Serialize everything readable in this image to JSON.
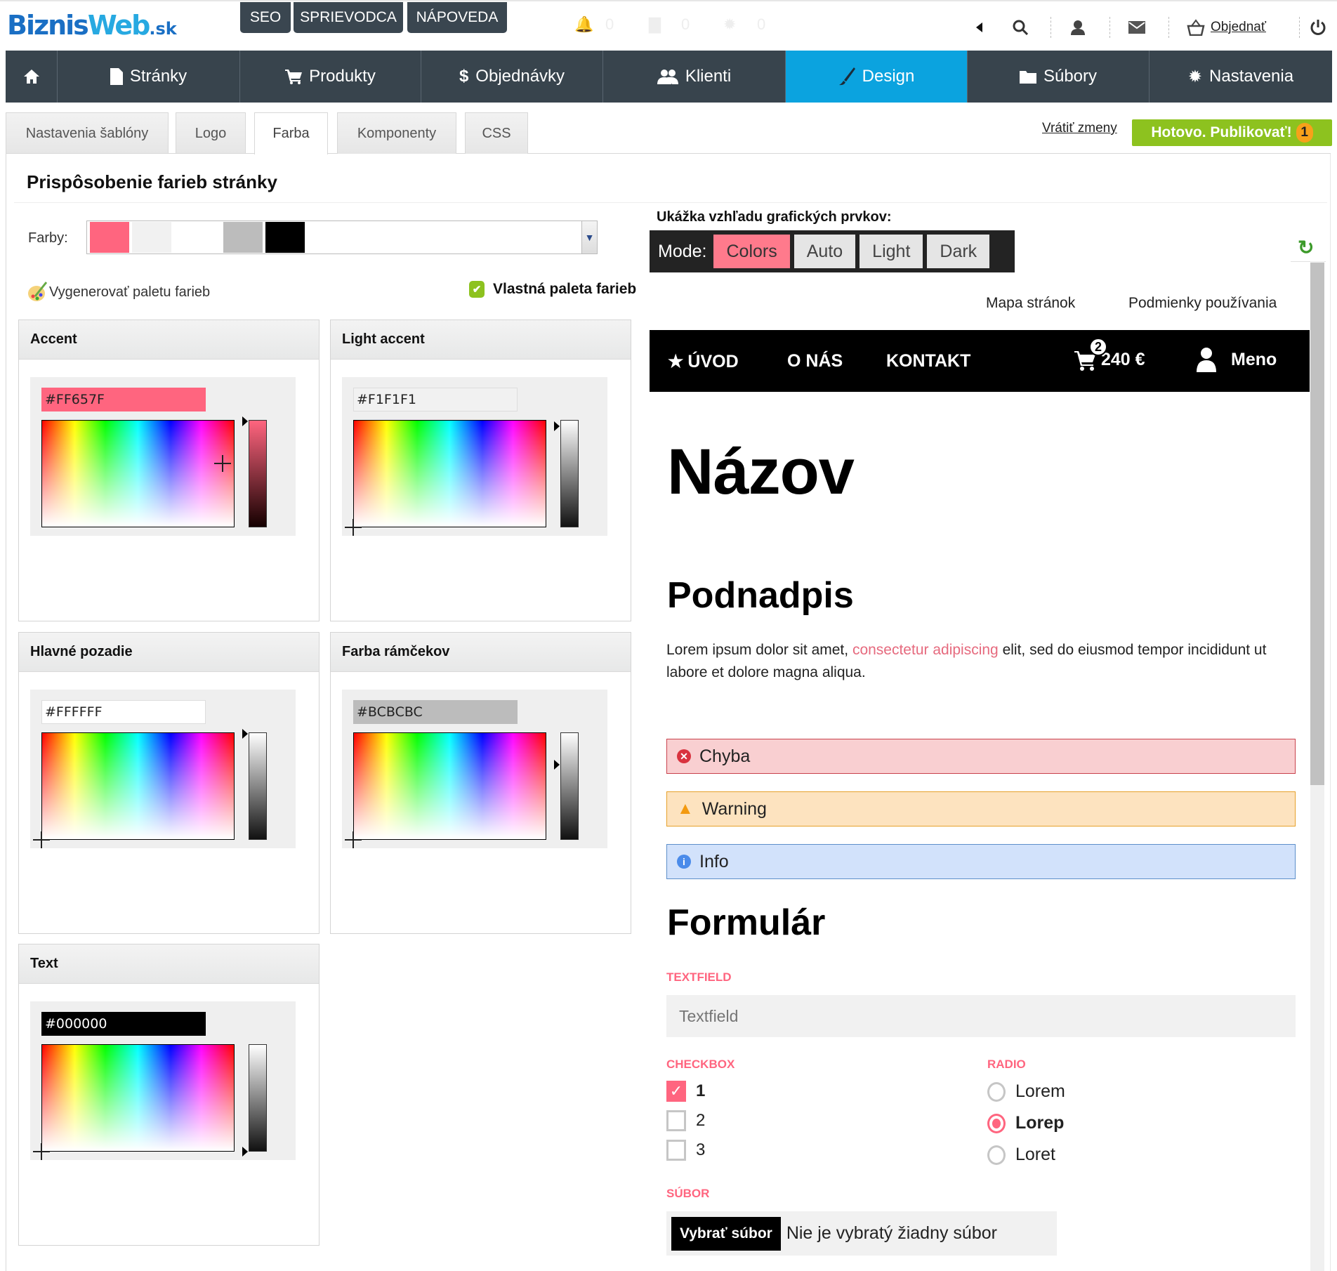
{
  "brand": {
    "part1": "Biznis",
    "part2": "Web",
    "part3": ".sk"
  },
  "top_buttons": [
    "SEO",
    "SPRIEVODCA",
    "NÁPOVEDA"
  ],
  "notifications": {
    "bell": "0",
    "orders": "0",
    "settings": "0"
  },
  "top_right": {
    "order_link": "Objednať"
  },
  "main_nav": [
    {
      "label": "",
      "icon": "home-icon"
    },
    {
      "label": "Stránky",
      "icon": "page-icon"
    },
    {
      "label": "Produkty",
      "icon": "cart-icon"
    },
    {
      "label": "Objednávky",
      "icon": "dollar-icon"
    },
    {
      "label": "Klienti",
      "icon": "users-icon"
    },
    {
      "label": "Design",
      "icon": "brush-icon",
      "active": true
    },
    {
      "label": "Súbory",
      "icon": "folder-icon"
    },
    {
      "label": "Nastavenia",
      "icon": "gear-icon"
    }
  ],
  "subtabs": [
    "Nastavenia šablóny",
    "Logo",
    "Farba",
    "Komponenty",
    "CSS"
  ],
  "active_subtab": "Farba",
  "actions": {
    "revert": "Vrátiť zmeny",
    "publish": "Hotovo. Publikovať!",
    "publish_badge": "1"
  },
  "page_title": "Prispôsobenie farieb stránky",
  "palette": {
    "label": "Farby:",
    "swatches": [
      "#FF657F",
      "#F1F1F1",
      "#FFFFFF",
      "#BCBCBC",
      "#000000"
    ],
    "generate_label": "Vygenerovať paletu farieb",
    "custom_palette_label": "Vlastná paleta farieb",
    "custom_palette_checked": true
  },
  "color_cards": [
    {
      "title": "Accent",
      "hex": "#FF657F"
    },
    {
      "title": "Light accent",
      "hex": "#F1F1F1"
    },
    {
      "title": "Hlavné pozadie",
      "hex": "#FFFFFF"
    },
    {
      "title": "Farba rámčekov",
      "hex": "#BCBCBC"
    },
    {
      "title": "Text",
      "hex": "#000000"
    }
  ],
  "preview": {
    "label": "Ukážka vzhľadu grafických prvkov:",
    "mode_label": "Mode:",
    "modes": [
      "Colors",
      "Auto",
      "Light",
      "Dark"
    ],
    "active_mode": "Colors",
    "top_links": [
      "Mapa stránok",
      "Podmienky používania"
    ],
    "site_nav": [
      "ÚVOD",
      "O NÁS",
      "KONTAKT"
    ],
    "cart_count": "2",
    "cart_total": "240 €",
    "user_label": "Meno",
    "heading1": "Názov",
    "heading2": "Podnadpis",
    "paragraph_start": "Lorem ipsum dolor sit amet, ",
    "paragraph_link": "consectetur adipiscing",
    "paragraph_end": " elit, sed do eiusmod tempor incididunt ut labore et dolore magna aliqua.",
    "alerts": [
      {
        "type": "error",
        "text": "Chyba"
      },
      {
        "type": "warning",
        "text": "Warning"
      },
      {
        "type": "info",
        "text": "Info"
      }
    ],
    "form_title": "Formulár",
    "textfield_label": "TEXTFIELD",
    "textfield_placeholder": "Textfield",
    "checkbox_label": "CHECKBOX",
    "checkboxes": [
      {
        "label": "1",
        "checked": true
      },
      {
        "label": "2",
        "checked": false
      },
      {
        "label": "3",
        "checked": false
      }
    ],
    "radio_label": "RADIO",
    "radios": [
      {
        "label": "Lorem",
        "checked": false
      },
      {
        "label": "Lorep",
        "checked": true
      },
      {
        "label": "Loret",
        "checked": false
      }
    ],
    "file_label": "SÚBOR",
    "file_button": "Vybrať súbor",
    "file_status": "Nie je vybratý žiadny súbor"
  },
  "colors": {
    "nav_bg": "#38444D",
    "nav_active": "#0BA3DF",
    "publish_green": "#8DC21F",
    "accent": "#FF657F"
  }
}
